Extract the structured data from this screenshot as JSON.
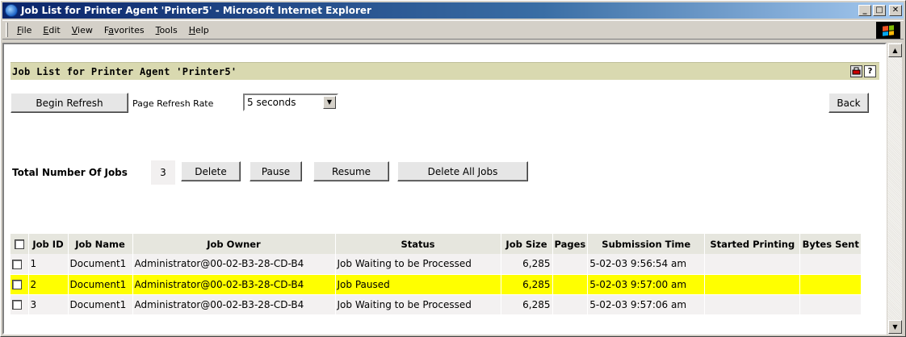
{
  "window": {
    "title": "Job List for Printer Agent 'Printer5' - Microsoft Internet Explorer",
    "buttons": {
      "minimize": "_",
      "maximize": "□",
      "close": "✕"
    }
  },
  "menu": [
    {
      "label": "File",
      "accel": "F",
      "rest": "ile"
    },
    {
      "label": "Edit",
      "accel": "E",
      "rest": "dit"
    },
    {
      "label": "View",
      "accel": "V",
      "rest": "iew"
    },
    {
      "label": "Favorites",
      "accel": "a",
      "rest": "vorites",
      "pre": "F"
    },
    {
      "label": "Tools",
      "accel": "T",
      "rest": "ools"
    },
    {
      "label": "Help",
      "accel": "H",
      "rest": "elp"
    }
  ],
  "page": {
    "title": "Job List for Printer Agent 'Printer5'",
    "header_icons": [
      "printer-icon",
      "help-icon"
    ],
    "help_glyph": "?",
    "refresh_button": "Begin Refresh",
    "refresh_rate_label": "Page Refresh Rate",
    "refresh_rate_value": "5 seconds",
    "back_button": "Back",
    "total_jobs_label": "Total Number Of Jobs",
    "total_jobs_value": "3",
    "actions": {
      "delete": "Delete",
      "pause": "Pause",
      "resume": "Resume",
      "delete_all": "Delete All Jobs"
    }
  },
  "table": {
    "columns": [
      "Job ID",
      "Job Name",
      "Job Owner",
      "Status",
      "Job Size",
      "Pages",
      "Submission Time",
      "Started Printing",
      "Bytes Sent"
    ],
    "rows": [
      {
        "id": "1",
        "name": "Document1",
        "owner": "Administrator@00-02-B3-28-CD-B4",
        "status": "Job Waiting to be Processed",
        "size": "6,285",
        "pages": "",
        "submitted": "5-02-03 9:56:54 am",
        "started": "",
        "bytes": "",
        "highlight": false
      },
      {
        "id": "2",
        "name": "Document1",
        "owner": "Administrator@00-02-B3-28-CD-B4",
        "status": "Job Paused",
        "size": "6,285",
        "pages": "",
        "submitted": "5-02-03 9:57:00 am",
        "started": "",
        "bytes": "",
        "highlight": true
      },
      {
        "id": "3",
        "name": "Document1",
        "owner": "Administrator@00-02-B3-28-CD-B4",
        "status": "Job Waiting to be Processed",
        "size": "6,285",
        "pages": "",
        "submitted": "5-02-03 9:57:06 am",
        "started": "",
        "bytes": "",
        "highlight": false
      }
    ]
  },
  "colors": {
    "title_gradient_start": "#0a246a",
    "header_bar": "#d9d9b0",
    "paused_row": "#ffff00",
    "row_bg": "#f3f1f1"
  }
}
